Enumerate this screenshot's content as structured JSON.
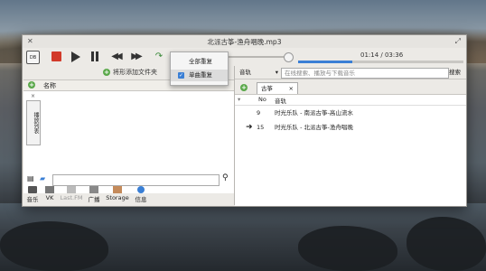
{
  "window": {
    "title": "北派古筝-渔舟唱晚.mp3"
  },
  "player": {
    "logo_label": "DB",
    "time": "01:14 / 03:36",
    "progress_fraction": 0.33,
    "volume_fraction": 0.93
  },
  "repeat_menu": {
    "items": [
      {
        "label": "全部重复",
        "checked": false
      },
      {
        "label": "单曲重复",
        "checked": true
      }
    ]
  },
  "left_panel": {
    "add_folder_label": "将形添加文件夹",
    "column_name": "名称",
    "vertical_tab": "播放列表",
    "source_tabs": [
      {
        "label": "音乐",
        "icon": "music-library-icon",
        "enabled": true
      },
      {
        "label": "VK",
        "icon": "vk-icon",
        "enabled": true
      },
      {
        "label": "Last.FM",
        "icon": "lastfm-icon",
        "enabled": false
      },
      {
        "label": "广播",
        "icon": "radio-icon",
        "enabled": true
      },
      {
        "label": "Storage",
        "icon": "storage-icon",
        "enabled": true
      },
      {
        "label": "信息",
        "icon": "info-icon",
        "enabled": true
      }
    ]
  },
  "right_panel": {
    "search_mode": "音轨",
    "search_placeholder": "在线搜索、播放与下载音乐",
    "search_button": "搜索",
    "tab_label": "古筝",
    "columns": {
      "no": "No",
      "track": "音轨"
    },
    "tracks": [
      {
        "no": "9",
        "title": "时光乐队 - 南派古筝-高山流水",
        "playing": false
      },
      {
        "no": "15",
        "title": "时光乐队 - 北派古筝-渔舟唱晚",
        "playing": true
      }
    ]
  }
}
